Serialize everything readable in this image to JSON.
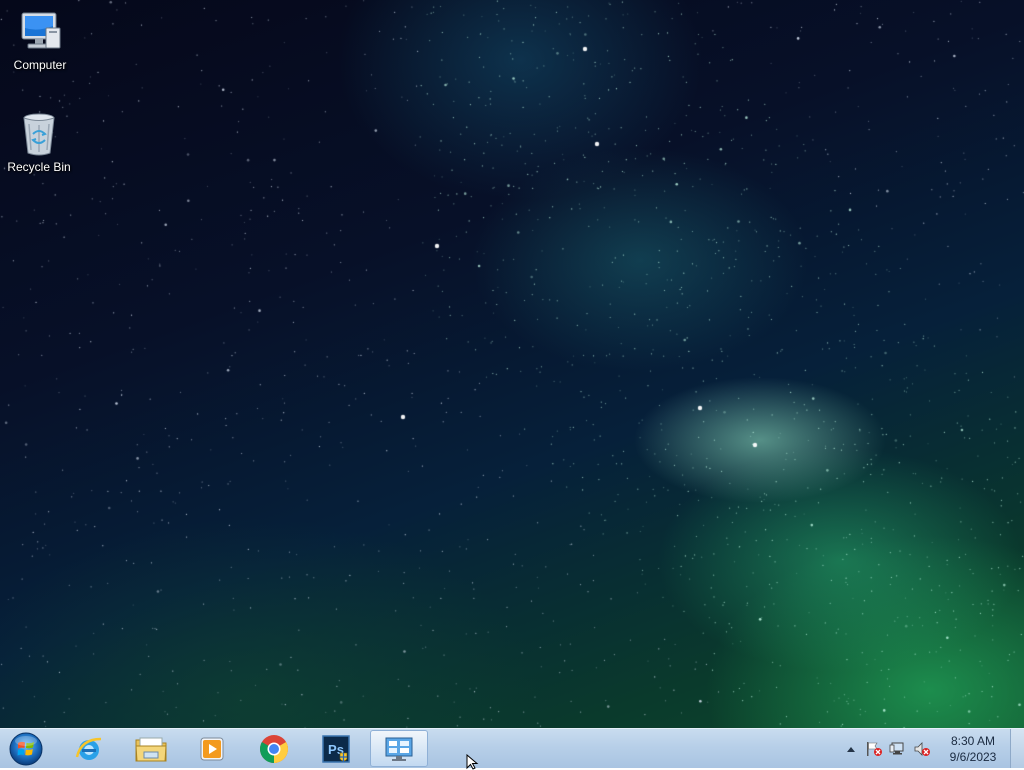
{
  "desktop": {
    "wallpaper": "milky-way-starfield",
    "icons": [
      {
        "label": "Computer",
        "icon": "computer-icon"
      },
      {
        "label": "Recycle Bin",
        "icon": "recycle-bin-icon"
      }
    ]
  },
  "taskbar": {
    "start": {
      "icon": "windows-start-orb-icon"
    },
    "pinned": [
      {
        "name": "internet-explorer",
        "icon": "internet-explorer-icon"
      },
      {
        "name": "file-explorer",
        "icon": "folder-icon"
      },
      {
        "name": "media-player",
        "icon": "media-player-icon"
      },
      {
        "name": "chrome",
        "icon": "chrome-icon"
      },
      {
        "name": "photoshop",
        "icon": "photoshop-icon",
        "text": "Ps"
      },
      {
        "name": "control-panel",
        "icon": "control-panel-icon",
        "active": true
      }
    ],
    "tray": {
      "icons": [
        "show-hidden-icons-arrow-icon",
        "action-center-flag-icon",
        "network-icon",
        "volume-muted-icon"
      ],
      "time": "8:30 AM",
      "date": "9/6/2023"
    }
  },
  "colors": {
    "taskbar_top": "#c9dcef",
    "taskbar_bottom": "#a9c4e2",
    "milky_way_green": "#28be64"
  }
}
